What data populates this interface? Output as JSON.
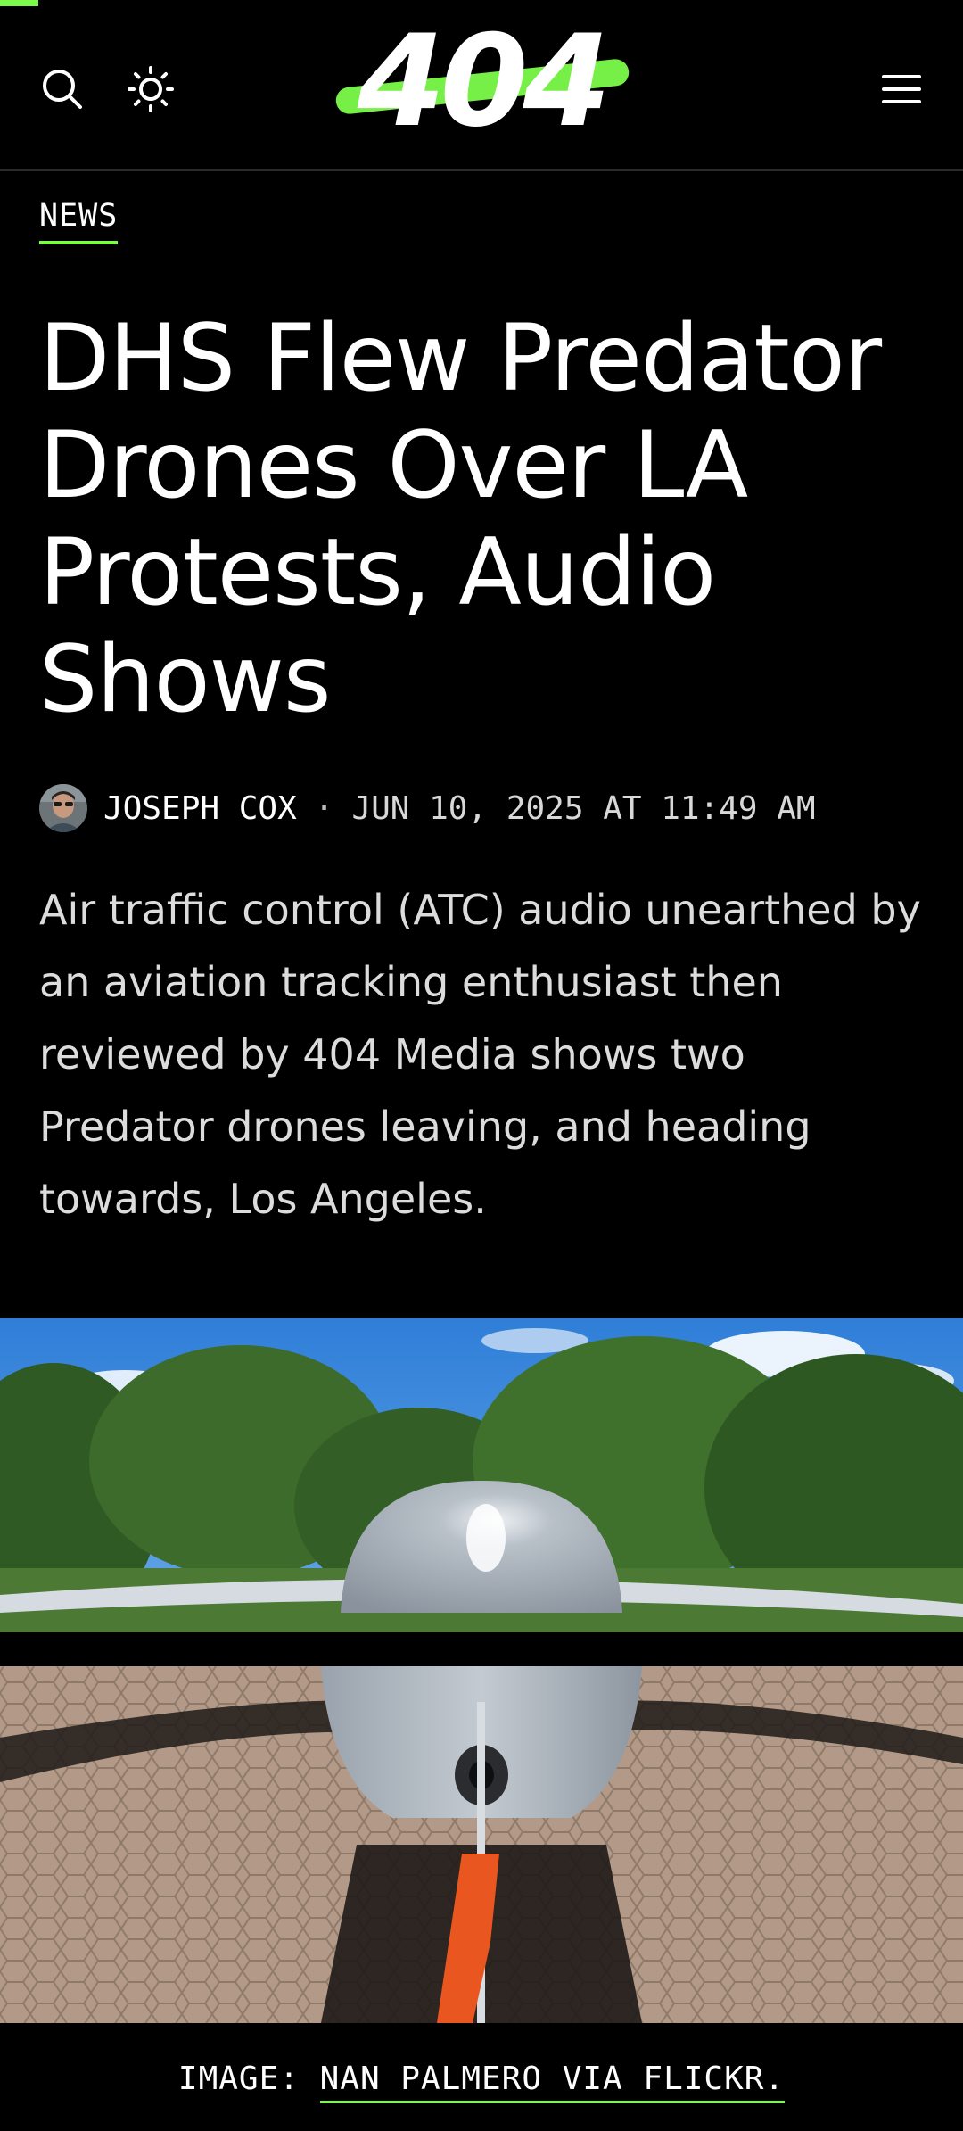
{
  "reading_progress": 0.04,
  "colors": {
    "accent": "#7CFC4A",
    "background": "#000000",
    "text": "#FFFFFF"
  },
  "header": {
    "logo_text": "404",
    "icons": [
      "search-icon",
      "sun-icon",
      "hamburger-menu-icon"
    ]
  },
  "article": {
    "category": "NEWS",
    "title": "DHS Flew Predator Drones Over LA Protests, Audio Shows",
    "author": "JOSEPH COX",
    "separator": "·",
    "date": "JUN 10, 2025 AT 11:49 AM",
    "dek": "Air traffic control (ATC) audio unearthed by an aviation tracking enthusiast then reviewed by 404 Media shows two Predator drones leaving, and heading towards, Los Angeles."
  },
  "image": {
    "caption_prefix": "IMAGE: ",
    "caption_credit": "NAN PALMERO VIA FLICKR."
  }
}
